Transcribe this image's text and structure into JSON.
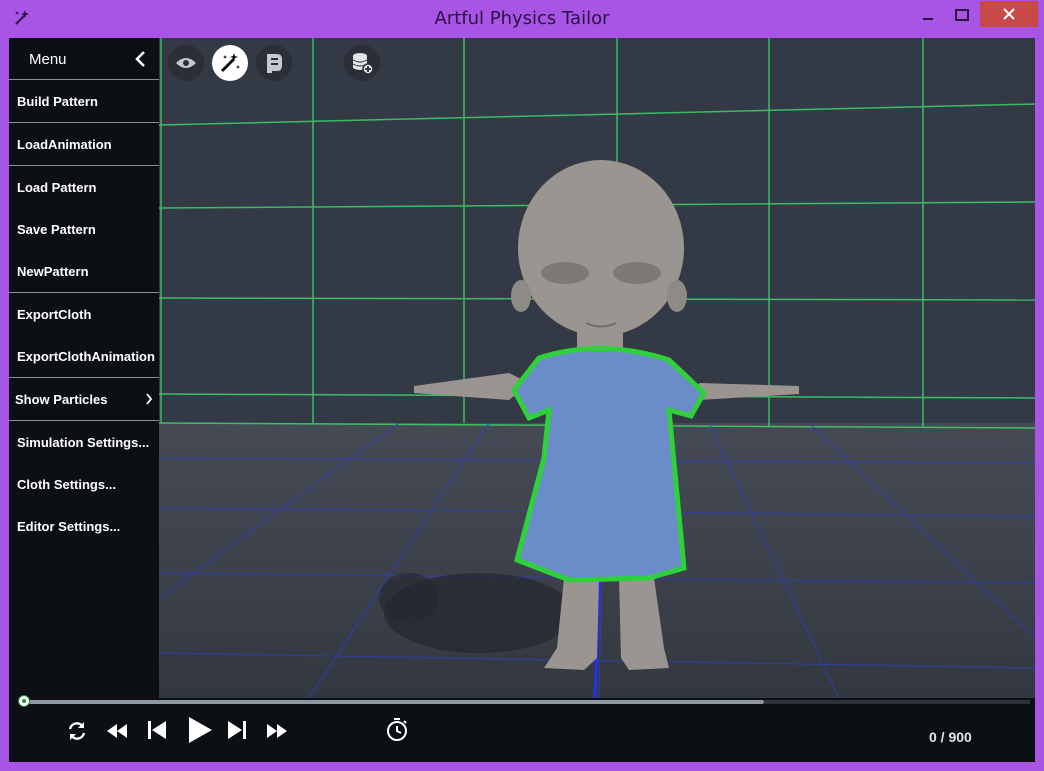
{
  "window": {
    "title": "Artful Physics Tailor",
    "app_icon": "magic-wand-icon",
    "controls": [
      "minimize-icon",
      "maximize-icon",
      "close-icon"
    ],
    "accent": "#a855e6",
    "close_color": "#c84a48"
  },
  "menu": {
    "title": "Menu",
    "back_icon": "chevron-left-icon",
    "items": [
      {
        "label": "Build Pattern"
      },
      {
        "label": "LoadAnimation"
      },
      {
        "label": "Load Pattern"
      },
      {
        "label": "Save Pattern"
      },
      {
        "label": "NewPattern"
      },
      {
        "label": "ExportCloth"
      },
      {
        "label": "ExportClothAnimation"
      },
      {
        "label": "Show Particles",
        "submenu_icon": "chevron-right-icon"
      },
      {
        "label": "Simulation Settings..."
      },
      {
        "label": "Cloth Settings..."
      },
      {
        "label": "Editor Settings..."
      }
    ]
  },
  "toolbar": {
    "tools": [
      "eye-icon",
      "magic-wand-icon",
      "pattern-icon",
      "database-add-icon"
    ],
    "active": "magic-wand-icon"
  },
  "playback": {
    "controls": [
      "loop-icon",
      "rewind-icon",
      "skip-back-icon",
      "play-icon",
      "skip-forward-icon",
      "fast-forward-icon",
      "timer-icon"
    ],
    "frame_counter": "0 / 900",
    "progress": 0,
    "timeline_color": "#2b8a3e"
  },
  "scene": {
    "grid_wall_color": "#3ddc6a",
    "grid_floor_color": "#3a4ed8",
    "cloth_color": "#6a8cc8",
    "cloth_outline_color": "#2fd13a",
    "character_color": "#9a9590"
  }
}
